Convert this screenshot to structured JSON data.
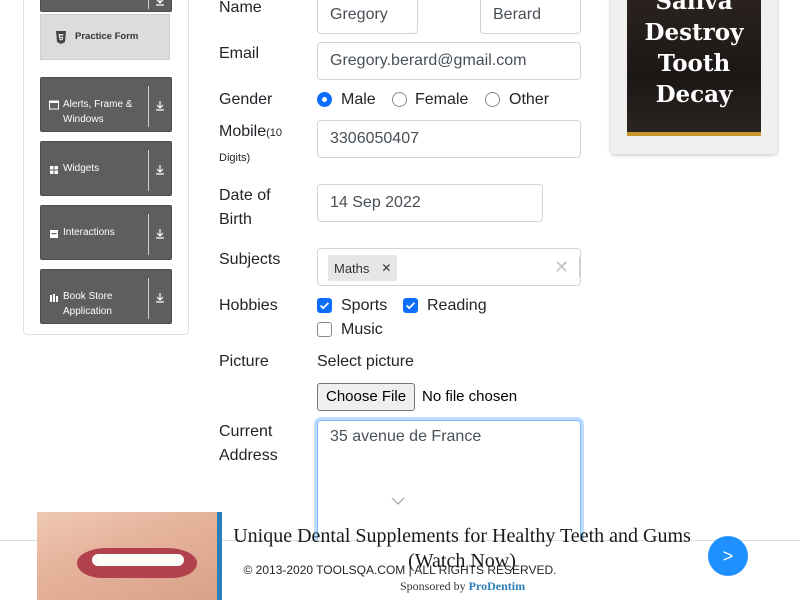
{
  "sidebar": {
    "practice_form": "Practice Form",
    "groups": [
      {
        "label_line1": "Alerts, Frame &",
        "label_line2": "Windows",
        "icon": "window-icon"
      },
      {
        "label_line1": "Widgets",
        "label_line2": "",
        "icon": "widgets-icon"
      },
      {
        "label_line1": "Interactions",
        "label_line2": "",
        "icon": "interactions-icon"
      },
      {
        "label_line1": "Book Store",
        "label_line2": "Application",
        "icon": "book-icon"
      }
    ]
  },
  "form": {
    "name_label": "Name",
    "first_name": "Gregory",
    "last_name": "Berard",
    "email_label": "Email",
    "email": "Gregory.berard@gmail.com",
    "gender_label": "Gender",
    "gender_options": [
      "Male",
      "Female",
      "Other"
    ],
    "gender_selected": "Male",
    "mobile_label": "Mobile",
    "mobile_hint": "(10",
    "mobile_hint2": "Digits)",
    "mobile": "3306050407",
    "dob_label_line1": "Date of",
    "dob_label_line2": "Birth",
    "dob": "14 Sep 2022",
    "subjects_label": "Subjects",
    "subjects": [
      "Maths"
    ],
    "hobbies_label": "Hobbies",
    "hobbies": [
      {
        "label": "Sports",
        "checked": true
      },
      {
        "label": "Reading",
        "checked": true
      },
      {
        "label": "Music",
        "checked": false
      }
    ],
    "picture_label": "Picture",
    "select_picture": "Select picture",
    "choose_file": "Choose File",
    "no_file": "No file chosen",
    "address_label_line1": "Current",
    "address_label_line2": "Address",
    "address": "35 avenue de France"
  },
  "ad": {
    "line1": "Saliva",
    "line2": "Destroy",
    "line3": "Tooth",
    "line4": "Decay"
  },
  "banner": {
    "title": "Unique Dental Supplements for Healthy Teeth and Gums (Watch Now)",
    "sponsored_prefix": "Sponsored by",
    "sponsor": "ProDentim",
    "next": ">"
  },
  "footer": {
    "copyright": "© 2013-2020 TOOLSQA.COM | ALL RIGHTS RESERVED."
  },
  "colors": {
    "accent": "#0d6efd",
    "sidebar_group": "#5e5e5e",
    "banner_button": "#1e90ff"
  }
}
